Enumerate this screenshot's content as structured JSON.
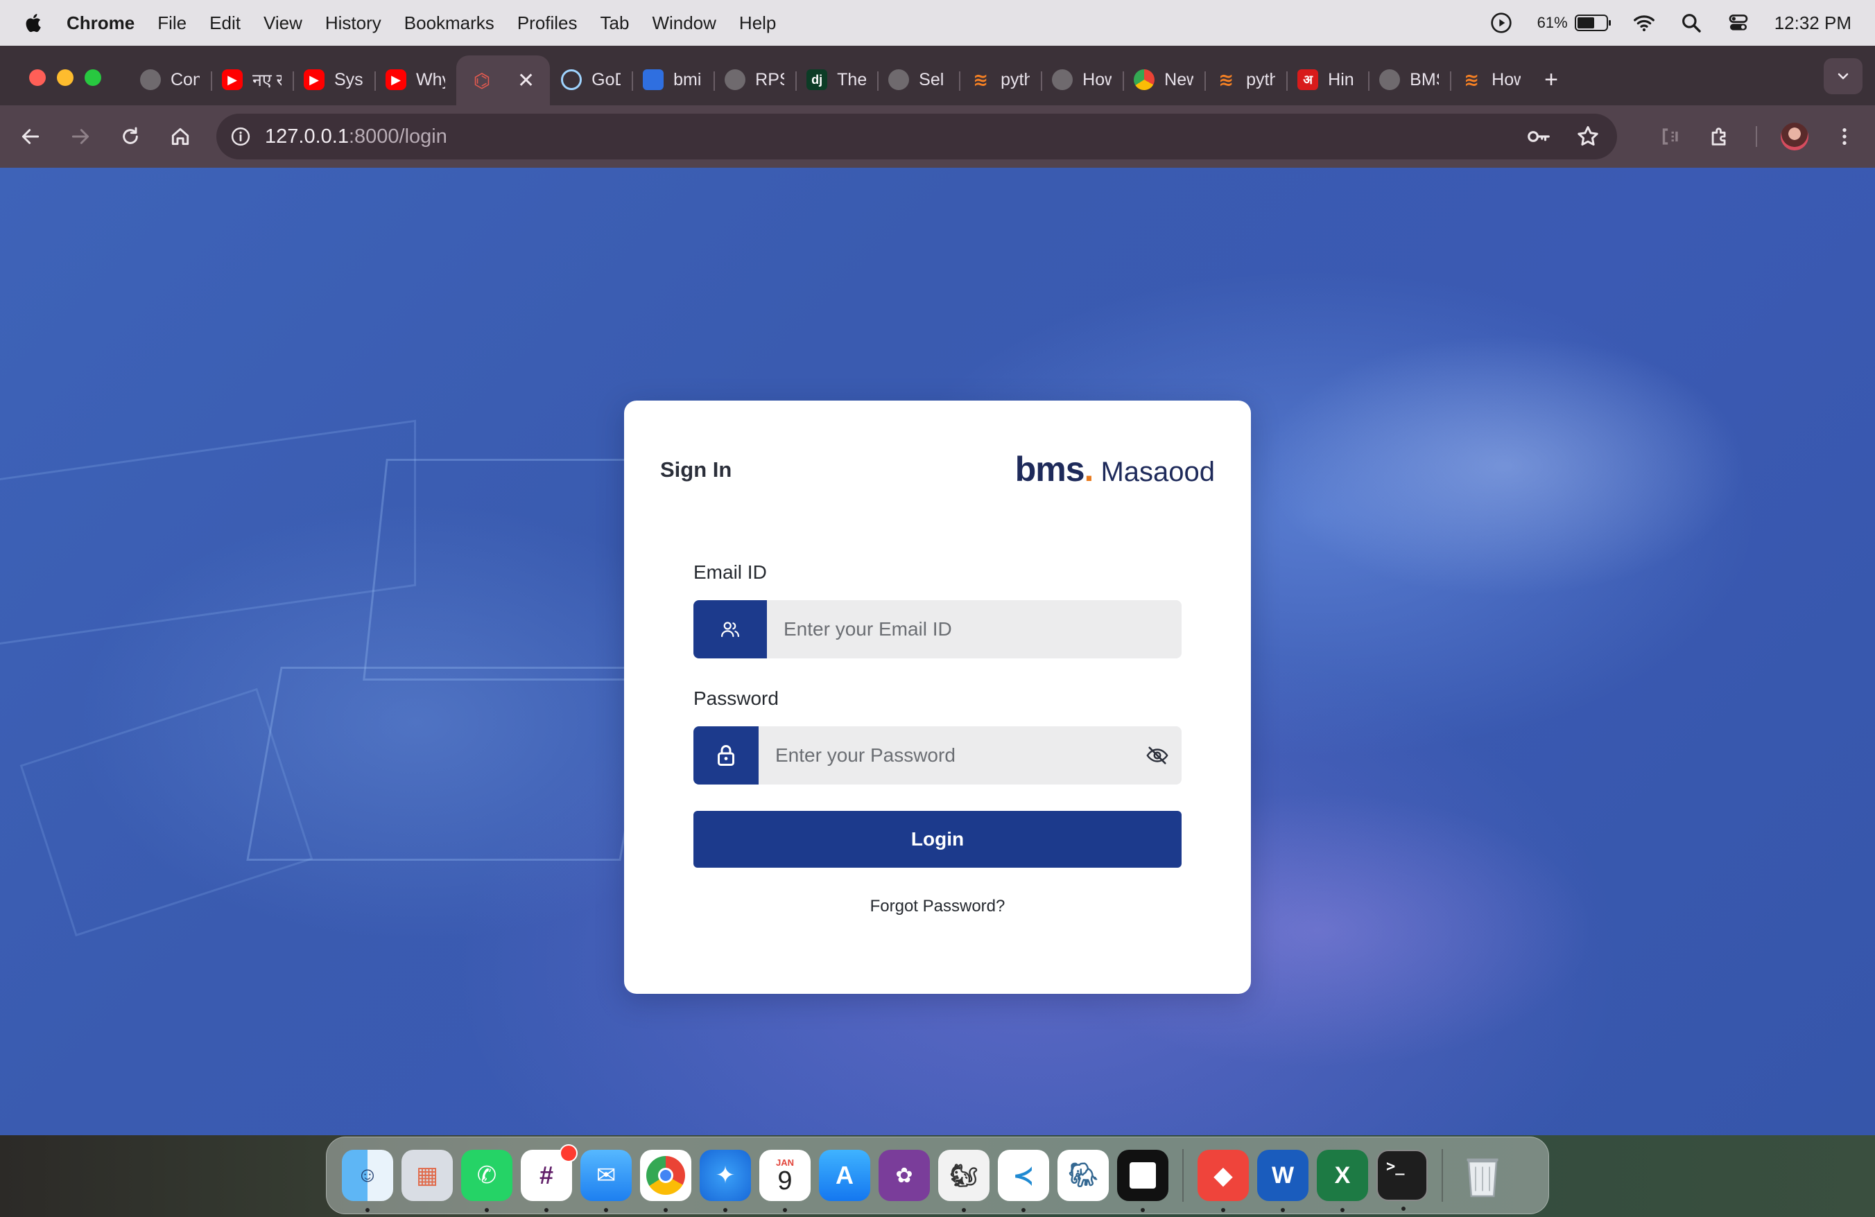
{
  "menubar": {
    "app_name": "Chrome",
    "items": [
      "File",
      "Edit",
      "View",
      "History",
      "Bookmarks",
      "Profiles",
      "Tab",
      "Window",
      "Help"
    ],
    "battery_percent": "61%",
    "battery_level": 0.61,
    "clock": "12:32 PM"
  },
  "browser": {
    "tabs": [
      {
        "title": "Con",
        "icon": "globe-icon"
      },
      {
        "title": "नए र",
        "icon": "youtube-icon"
      },
      {
        "title": "Sys",
        "icon": "youtube-icon"
      },
      {
        "title": "Why",
        "icon": "youtube-icon"
      },
      {
        "title": "",
        "icon": "laravel-icon",
        "active": true
      },
      {
        "title": "GoD",
        "icon": "chatgpt-icon"
      },
      {
        "title": "bmi",
        "icon": "bitbucket-icon"
      },
      {
        "title": "RPS",
        "icon": "globe-icon"
      },
      {
        "title": "The",
        "icon": "django-icon"
      },
      {
        "title": "Sel",
        "icon": "globe-icon"
      },
      {
        "title": "pyth",
        "icon": "stackoverflow-icon"
      },
      {
        "title": "How",
        "icon": "globe-icon"
      },
      {
        "title": "New",
        "icon": "chrome-icon"
      },
      {
        "title": "pyth",
        "icon": "stackoverflow-icon"
      },
      {
        "title": "Hin",
        "icon": "hindi-icon"
      },
      {
        "title": "BMS",
        "icon": "globe-icon"
      },
      {
        "title": "How",
        "icon": "stackoverflow-icon"
      }
    ],
    "url_host": "127.0.0.1",
    "url_rest": ":8000/login"
  },
  "login": {
    "title": "Sign In",
    "brand_main": "bms",
    "brand_dot": ".",
    "brand_sub": "Masaood",
    "email_label": "Email ID",
    "email_placeholder": "Enter your Email ID",
    "password_label": "Password",
    "password_placeholder": "Enter your Password",
    "login_button": "Login",
    "forgot_link": "Forgot Password?"
  },
  "colors": {
    "primary": "#1c3a8c",
    "brand_text": "#1e2a5a",
    "brand_accent": "#e87a1f",
    "background": "#3a5bb0"
  },
  "dock": {
    "calendar_month": "JAN",
    "calendar_day": "9",
    "apps": [
      "finder-icon",
      "launchpad-icon",
      "whatsapp-icon",
      "slack-icon",
      "mail-icon",
      "chrome-icon",
      "safari-icon",
      "calendar-icon",
      "app-store-icon",
      "viber-business-icon",
      "sequel-ace-icon",
      "vscode-icon",
      "postgres-icon",
      "notion-icon",
      "anydesk-icon",
      "word-icon",
      "excel-icon",
      "terminal-icon",
      "trash-icon"
    ]
  }
}
